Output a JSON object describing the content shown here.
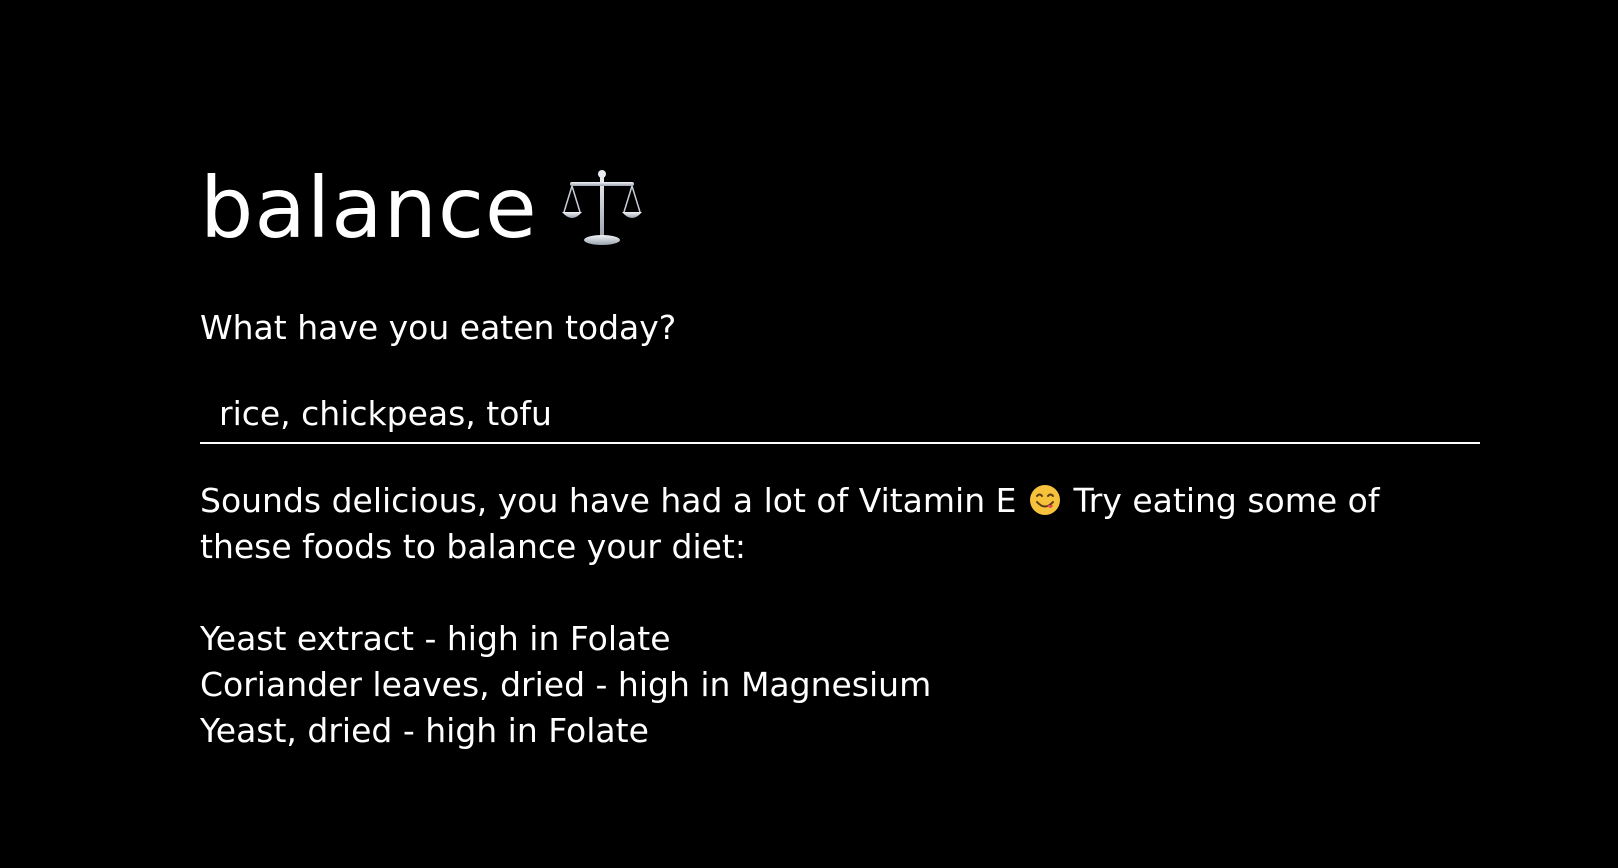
{
  "app": {
    "title": "balance",
    "title_icon": "balance-scale-icon"
  },
  "form": {
    "prompt": "What have you eaten today?",
    "input_value": "rice, chickpeas, tofu"
  },
  "result": {
    "message_part1": "Sounds delicious, you have had a lot of Vitamin E",
    "emoji": "yum-face-icon",
    "message_part2": "Try eating some of these foods to balance your diet:",
    "suggestions": [
      "Yeast extract - high in Folate",
      "Coriander leaves, dried - high in Magnesium",
      "Yeast, dried - high in Folate"
    ]
  },
  "colors": {
    "background": "#000000",
    "text": "#ffffff"
  }
}
